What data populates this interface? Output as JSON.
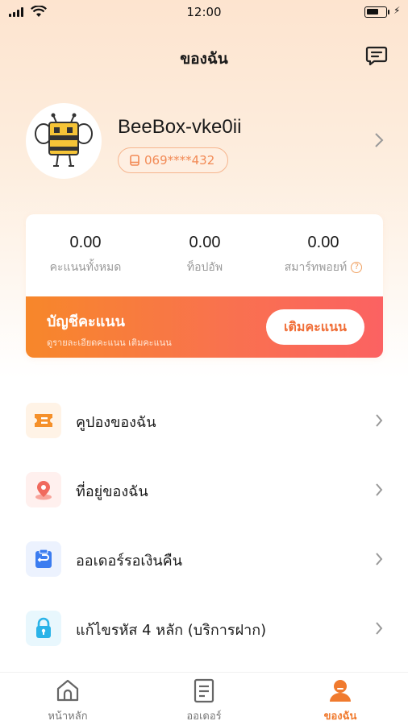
{
  "status_bar": {
    "time": "12:00"
  },
  "header": {
    "title": "ของฉัน",
    "message_icon": "message-icon"
  },
  "profile": {
    "username": "BeeBox-vke0ii",
    "phone": "069****432",
    "avatar_icon": "bee-mascot-avatar"
  },
  "stats": [
    {
      "value": "0.00",
      "label": "คะแนนทั้งหมด"
    },
    {
      "value": "0.00",
      "label": "ท็อปอัพ"
    },
    {
      "value": "0.00",
      "label": "สมาร์ทพอยท์"
    }
  ],
  "points_account": {
    "title": "บัญชีคะแนน",
    "subtitle": "ดูรายละเอียดคะแนน เติมคะแนน",
    "button": "เติมคะแนน"
  },
  "menu": [
    {
      "label": "คูปองของฉัน",
      "icon": "coupon-icon",
      "color": "#f5902a"
    },
    {
      "label": "ที่อยู่ของฉัน",
      "icon": "location-pin-icon",
      "color": "#f06a5e"
    },
    {
      "label": "ออเดอร์รอเงินคืน",
      "icon": "refund-icon",
      "color": "#3b7cf0"
    },
    {
      "label": "แก้ไขรหัส 4 หลัก (บริการฝาก)",
      "icon": "lock-icon",
      "color": "#2ab3e8"
    }
  ],
  "tabs": [
    {
      "label": "หน้าหลัก",
      "icon": "home-icon",
      "active": false
    },
    {
      "label": "ออเดอร์",
      "icon": "order-list-icon",
      "active": false
    },
    {
      "label": "ของฉัน",
      "icon": "profile-icon",
      "active": true
    }
  ],
  "colors": {
    "accent": "#f07a2e",
    "gradient_start": "#f7872a",
    "gradient_end": "#fb6262"
  }
}
